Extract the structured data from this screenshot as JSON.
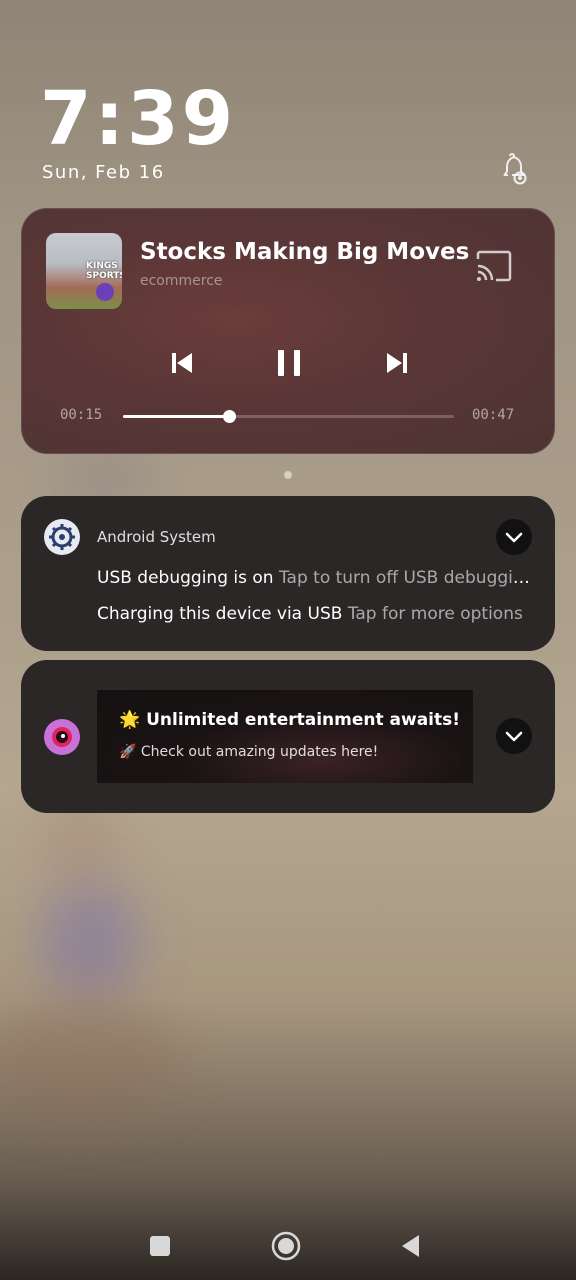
{
  "lockscreen": {
    "time": "7:39",
    "date": "Sun, Feb 16"
  },
  "media": {
    "title": "Stocks Making Big Moves Mi..",
    "source": "ecommerce",
    "art_text": "KINGS\nSPORTSBOOK",
    "elapsed": "00:15",
    "duration": "00:47",
    "progress_fraction": 0.32
  },
  "notifications": [
    {
      "app": "Android System",
      "lines": [
        {
          "title": "USB debugging is on",
          "text": "Tap to turn off USB debugging"
        },
        {
          "title": "Charging this device via USB",
          "text": "Tap for more options"
        }
      ]
    },
    {
      "app_icon": "game-app-icon",
      "banner_title": "🌟 Unlimited entertainment awaits!",
      "banner_subtitle": "🚀 Check out amazing updates here!"
    }
  ],
  "icons": {
    "notification_settings": "notification-settings-icon",
    "cast": "cast-icon",
    "previous": "skip-previous-icon",
    "pause": "pause-icon",
    "next": "skip-next-icon",
    "expand": "chevron-down-icon",
    "nav_recent": "recents-icon",
    "nav_home": "home-icon",
    "nav_back": "back-icon"
  },
  "colors": {
    "card_bg": "#2a2726",
    "media_bg": "#5a3636",
    "game_icon": "#c871d8"
  }
}
